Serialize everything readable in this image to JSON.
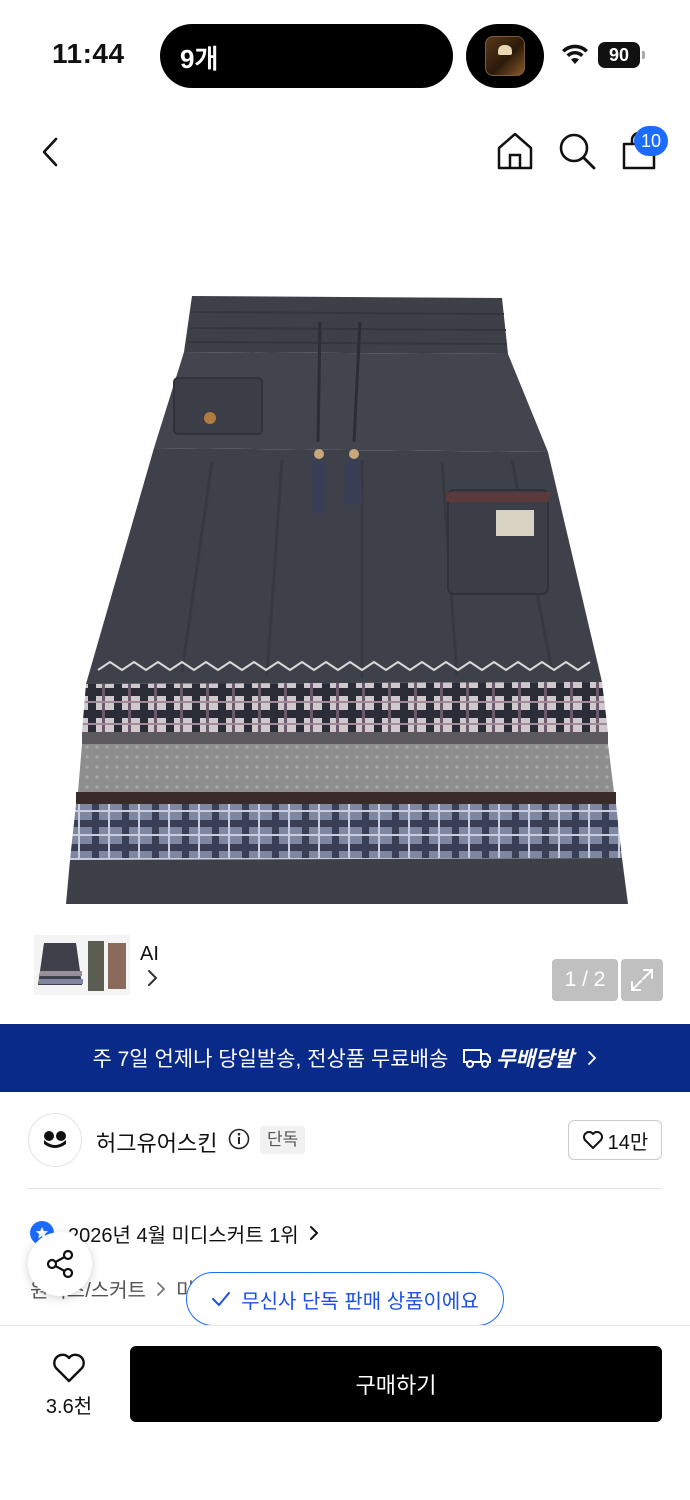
{
  "status_bar": {
    "time": "11:44",
    "island_text": "9개",
    "battery": "90",
    "icons": [
      "wifi-icon",
      "battery-icon",
      "now-playing-album-art"
    ]
  },
  "nav": {
    "icons": [
      "back-arrow-icon",
      "home-icon",
      "search-icon",
      "shopping-bag-icon"
    ],
    "cart_badge": "10",
    "accent_color": "#1b6bff"
  },
  "gallery": {
    "ai_label": "AI",
    "page_indicator": "1 / 2",
    "current_page": 1,
    "total_pages": 2,
    "icons": [
      "chevron-right-icon",
      "expand-icon"
    ]
  },
  "promo": {
    "text": "주 7일 언제나 당일발송, 전상품 무료배송",
    "logo_text": "무배당발",
    "background": "#0a2a8a"
  },
  "brand": {
    "name": "허그유어스킨",
    "exclusive_tag": "단독",
    "likes": "14만"
  },
  "ranking": {
    "text": "2026년 4월 미디스커트 1위"
  },
  "breadcrumb": {
    "items": [
      "원피스/스커트",
      "미"
    ]
  },
  "toast": {
    "text": "무신사 단독 판매 상품이에요"
  },
  "bottom_bar": {
    "wish_count": "3.6천",
    "buy_label": "구매하기"
  }
}
